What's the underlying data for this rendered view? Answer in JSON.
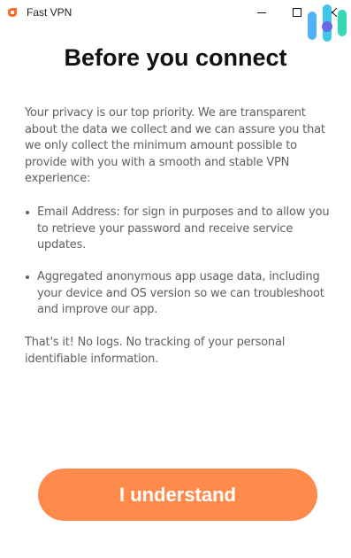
{
  "window": {
    "title": "Fast VPN",
    "icon": "fast-vpn-logo-icon",
    "controls": {
      "minimize_icon": "minimize-icon",
      "maximize_icon": "maximize-icon",
      "close_icon": "close-icon"
    }
  },
  "main": {
    "heading": "Before you connect",
    "intro": "Your privacy is our top priority. We are transparent about the data we collect and we can assure you that we only collect the minimum amount possible to provide with you with a smooth and stable VPN experience:",
    "bullets": [
      {
        "text": "Email Address: for sign in purposes and to allow you to retrieve your password and receive service updates."
      },
      {
        "text": "Aggregated anonymous app usage data, including your device and OS version so we can troubleshoot and improve our app."
      }
    ],
    "outro": "That's it! No logs. No tracking of your personal identifiable information.",
    "cta_label": "I understand"
  },
  "colors": {
    "accent": "#ff8a4c",
    "body_text": "#606060",
    "heading_text": "#111111",
    "background": "#ffffff"
  }
}
